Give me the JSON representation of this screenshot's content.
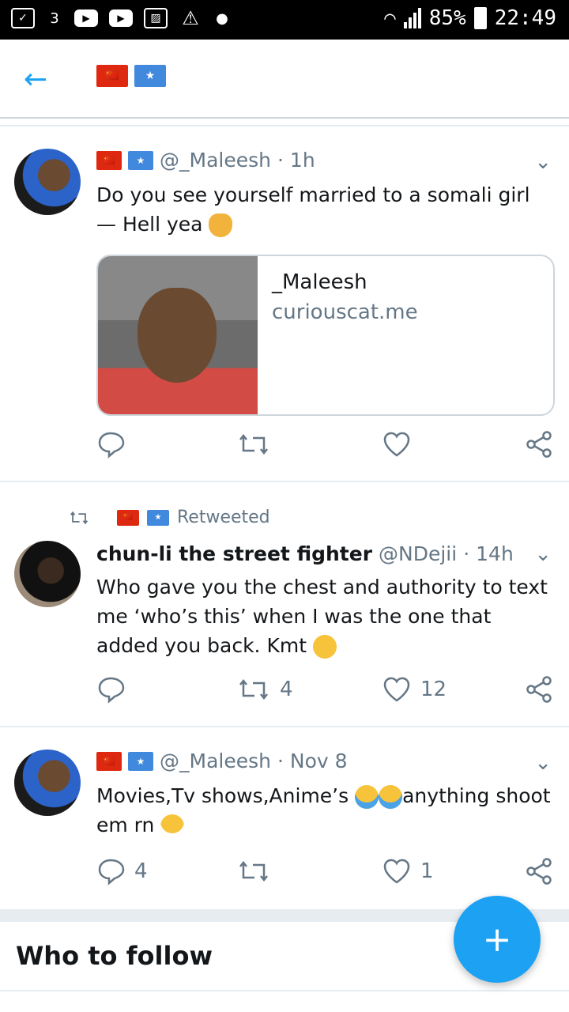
{
  "status_bar": {
    "battery": "85%",
    "time": "22:49",
    "carrier_icon": "3",
    "icons": [
      "screenshot-icon",
      "carrier-3-icon",
      "youtube-icon",
      "youtube-icon",
      "gallery-icon",
      "warning-icon",
      "alert-icon",
      "wifi-icon",
      "signal-icon",
      "battery-icon"
    ]
  },
  "header": {
    "back_icon": "arrow-left-icon",
    "flags": [
      "🇨🇳",
      "★"
    ]
  },
  "tweets": [
    {
      "flags": [
        "🇨🇳",
        "★"
      ],
      "handle": "@_Maleesh",
      "dot": "·",
      "time": "1h",
      "text": "Do you see yourself married to a somali girl — Hell yea",
      "card": {
        "title": "_Maleesh",
        "domain": "curiouscat.me"
      },
      "reply_count": "",
      "retweet_count": "",
      "like_count": ""
    },
    {
      "retweeted_label": "Retweeted",
      "name": "chun-li the street fighter",
      "handle": "@NDejii",
      "dot": "·",
      "time": "14h",
      "text": "Who gave you the chest and authority to text me ‘who’s this’ when I was the one that added you back. Kmt",
      "reply_count": "",
      "retweet_count": "4",
      "like_count": "12"
    },
    {
      "flags": [
        "🇨🇳",
        "★"
      ],
      "handle": "@_Maleesh",
      "dot": "·",
      "time": "Nov 8",
      "text_a": "Movies,Tv shows,Anime’s ",
      "text_b": "anything shoot em rn",
      "reply_count": "4",
      "retweet_count": "",
      "like_count": "1"
    }
  ],
  "who_to_follow": "Who to follow",
  "fab": {
    "icon": "compose-icon",
    "label": "+"
  },
  "colors": {
    "accent": "#1da1f2",
    "muted": "#657786",
    "text": "#14171a"
  }
}
